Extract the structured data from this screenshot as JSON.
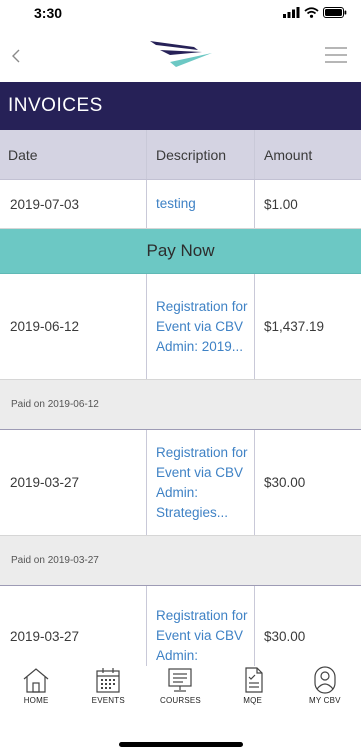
{
  "status_bar": {
    "time": "3:30"
  },
  "header": {
    "title": "INVOICES"
  },
  "table": {
    "columns": [
      "Date",
      "Description",
      "Amount"
    ],
    "rows": [
      {
        "date": "2019-07-03",
        "description": "testing",
        "amount": "$1.00"
      },
      {
        "date": "2019-06-12",
        "description": "Registration for Event via CBV Admin: 2019...",
        "amount": "$1,437.19"
      },
      {
        "date": "2019-03-27",
        "description": "Registration for Event via CBV Admin: Strategies...",
        "amount": "$30.00"
      },
      {
        "date": "2019-03-27",
        "description": "Registration for Event via CBV Admin:",
        "amount": "$30.00"
      }
    ],
    "pay_now_label": "Pay Now",
    "paid_notes": [
      {
        "prefix": "Paid on",
        "date": "2019-06-12"
      },
      {
        "prefix": "Paid on",
        "date": "2019-03-27"
      }
    ]
  },
  "tabs": [
    {
      "label": "HOME",
      "icon": "home-icon"
    },
    {
      "label": "EVENTS",
      "icon": "calendar-icon"
    },
    {
      "label": "COURSES",
      "icon": "monitor-icon"
    },
    {
      "label": "MQE",
      "icon": "document-icon"
    },
    {
      "label": "MY CBV",
      "icon": "user-icon"
    }
  ],
  "colors": {
    "header_bg": "#262157",
    "table_head_bg": "#d4d3e2",
    "pay_now_bg": "#6cc8c4",
    "link": "#3f82c5",
    "paid_bg": "#ececec"
  }
}
